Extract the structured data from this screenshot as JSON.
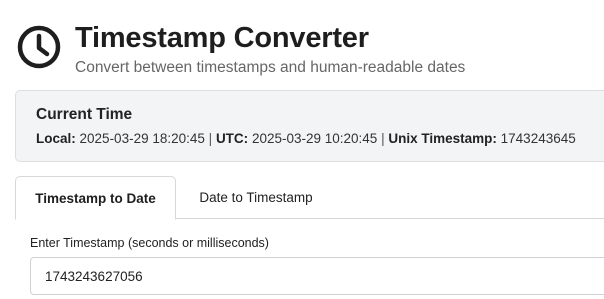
{
  "header": {
    "icon": "clock-icon",
    "title": "Timestamp Converter",
    "subtitle": "Convert between timestamps and human-readable dates"
  },
  "current_time": {
    "heading": "Current Time",
    "local_label": "Local:",
    "local_value": "2025-03-29 18:20:45",
    "utc_label": "UTC:",
    "utc_value": "2025-03-29 10:20:45",
    "unix_label": "Unix Timestamp:",
    "unix_value": "1743243645",
    "separator": "|"
  },
  "tabs": [
    {
      "label": "Timestamp to Date",
      "active": true
    },
    {
      "label": "Date to Timestamp",
      "active": false
    }
  ],
  "form": {
    "timestamp_label": "Enter Timestamp (seconds or milliseconds)",
    "timestamp_value": "1743243627056"
  },
  "colors": {
    "card_background": "#f3f4f5",
    "border": "#d6d8da",
    "subtitle_text": "#666666"
  }
}
